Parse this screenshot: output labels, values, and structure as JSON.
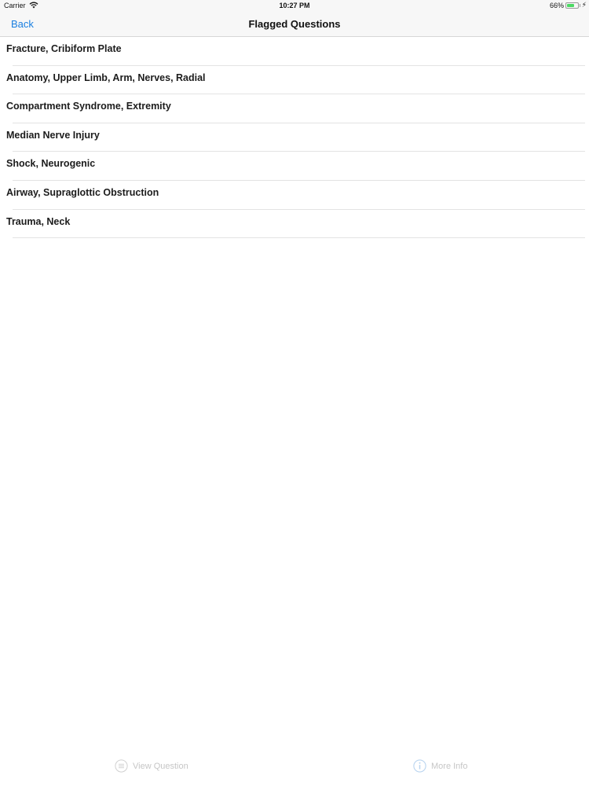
{
  "status_bar": {
    "carrier": "Carrier",
    "time": "10:27 PM",
    "battery_percent": "66%",
    "battery_level": 0.66,
    "wifi_icon": "wifi-icon",
    "charging_icon": "bolt-icon"
  },
  "nav": {
    "back_label": "Back",
    "title": "Flagged Questions"
  },
  "items": [
    {
      "label": "Fracture, Cribiform Plate"
    },
    {
      "label": "Anatomy, Upper Limb, Arm, Nerves, Radial"
    },
    {
      "label": "Compartment Syndrome, Extremity"
    },
    {
      "label": "Median Nerve Injury"
    },
    {
      "label": "Shock, Neurogenic"
    },
    {
      "label": "Airway, Supraglottic Obstruction"
    },
    {
      "label": "Trauma, Neck"
    }
  ],
  "toolbar": {
    "view_label": "View Question",
    "view_icon": "list-icon",
    "info_label": "More Info",
    "info_icon": "info-icon",
    "disabled_color": "#c6c6c6"
  },
  "colors": {
    "accent": "#1a7fe0",
    "battery_fill": "#4cd964"
  }
}
